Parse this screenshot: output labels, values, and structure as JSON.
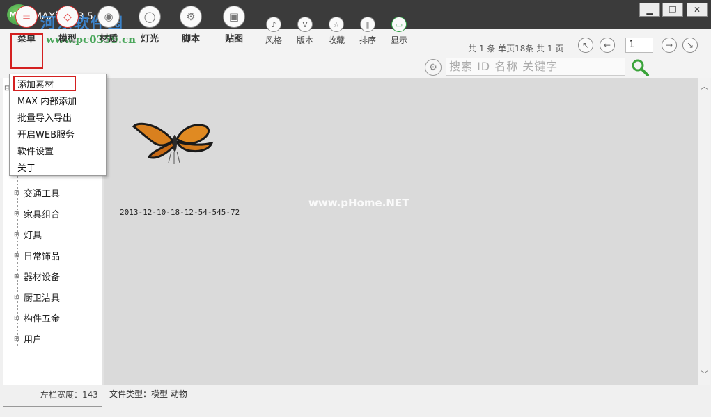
{
  "window": {
    "app_logo_text": "MAX",
    "title": "MAX管家 3.5",
    "watermark_text": "河东软件园",
    "watermark_url": "www.pc0359.cn",
    "min_glyph": "▁",
    "max_glyph": "❐",
    "close_glyph": "✕"
  },
  "toolbar": {
    "main_tools": [
      {
        "label": "菜单",
        "glyph": "≡"
      },
      {
        "label": "模型",
        "glyph": "◇"
      },
      {
        "label": "材质",
        "glyph": "◉"
      },
      {
        "label": "灯光",
        "glyph": "◯"
      },
      {
        "label": "脚本",
        "glyph": "⚙"
      },
      {
        "label": "贴图",
        "glyph": "▣"
      }
    ],
    "small_tools": [
      {
        "label": "风格",
        "glyph": "♪"
      },
      {
        "label": "版本",
        "glyph": "V"
      },
      {
        "label": "收藏",
        "glyph": "☆"
      },
      {
        "label": "排序",
        "glyph": "‖"
      },
      {
        "label": "显示",
        "glyph": "▭"
      }
    ],
    "pager_info": "共 1 条 单页18条 共 1 页",
    "nav_glyphs": {
      "first": "↖",
      "prev": "←",
      "next": "→",
      "last": "↘"
    },
    "page_value": "1",
    "settings_glyph": "⚙",
    "search_placeholder": "搜索  ID  名称  关键字"
  },
  "menu": {
    "items": [
      "添加素材",
      "MAX 内部添加",
      "批量导入导出",
      "开启WEB服务",
      "软件设置",
      "关于"
    ]
  },
  "sidebar": {
    "root_toggle": "⊟",
    "expander": "⊞",
    "categories": [
      "交通工具",
      "家具组合",
      "灯具",
      "日常饰品",
      "器材设备",
      "厨卫洁具",
      "构件五金",
      "用户"
    ]
  },
  "content": {
    "thumb_caption": "2013-12-10-18-12-54-545-72",
    "overlay_watermark": "www.pHome.NET"
  },
  "scrollbar": {
    "up_glyph": "︿",
    "down_glyph": "﹀"
  },
  "statusbar": {
    "left_label": "左栏宽度：143",
    "file_type": "文件类型：模型   动物"
  },
  "colors": {
    "titlebar": "#3b3b3b",
    "highlight_red": "#d42020",
    "content_bg": "#dadada",
    "green_accent": "#2ea043"
  }
}
